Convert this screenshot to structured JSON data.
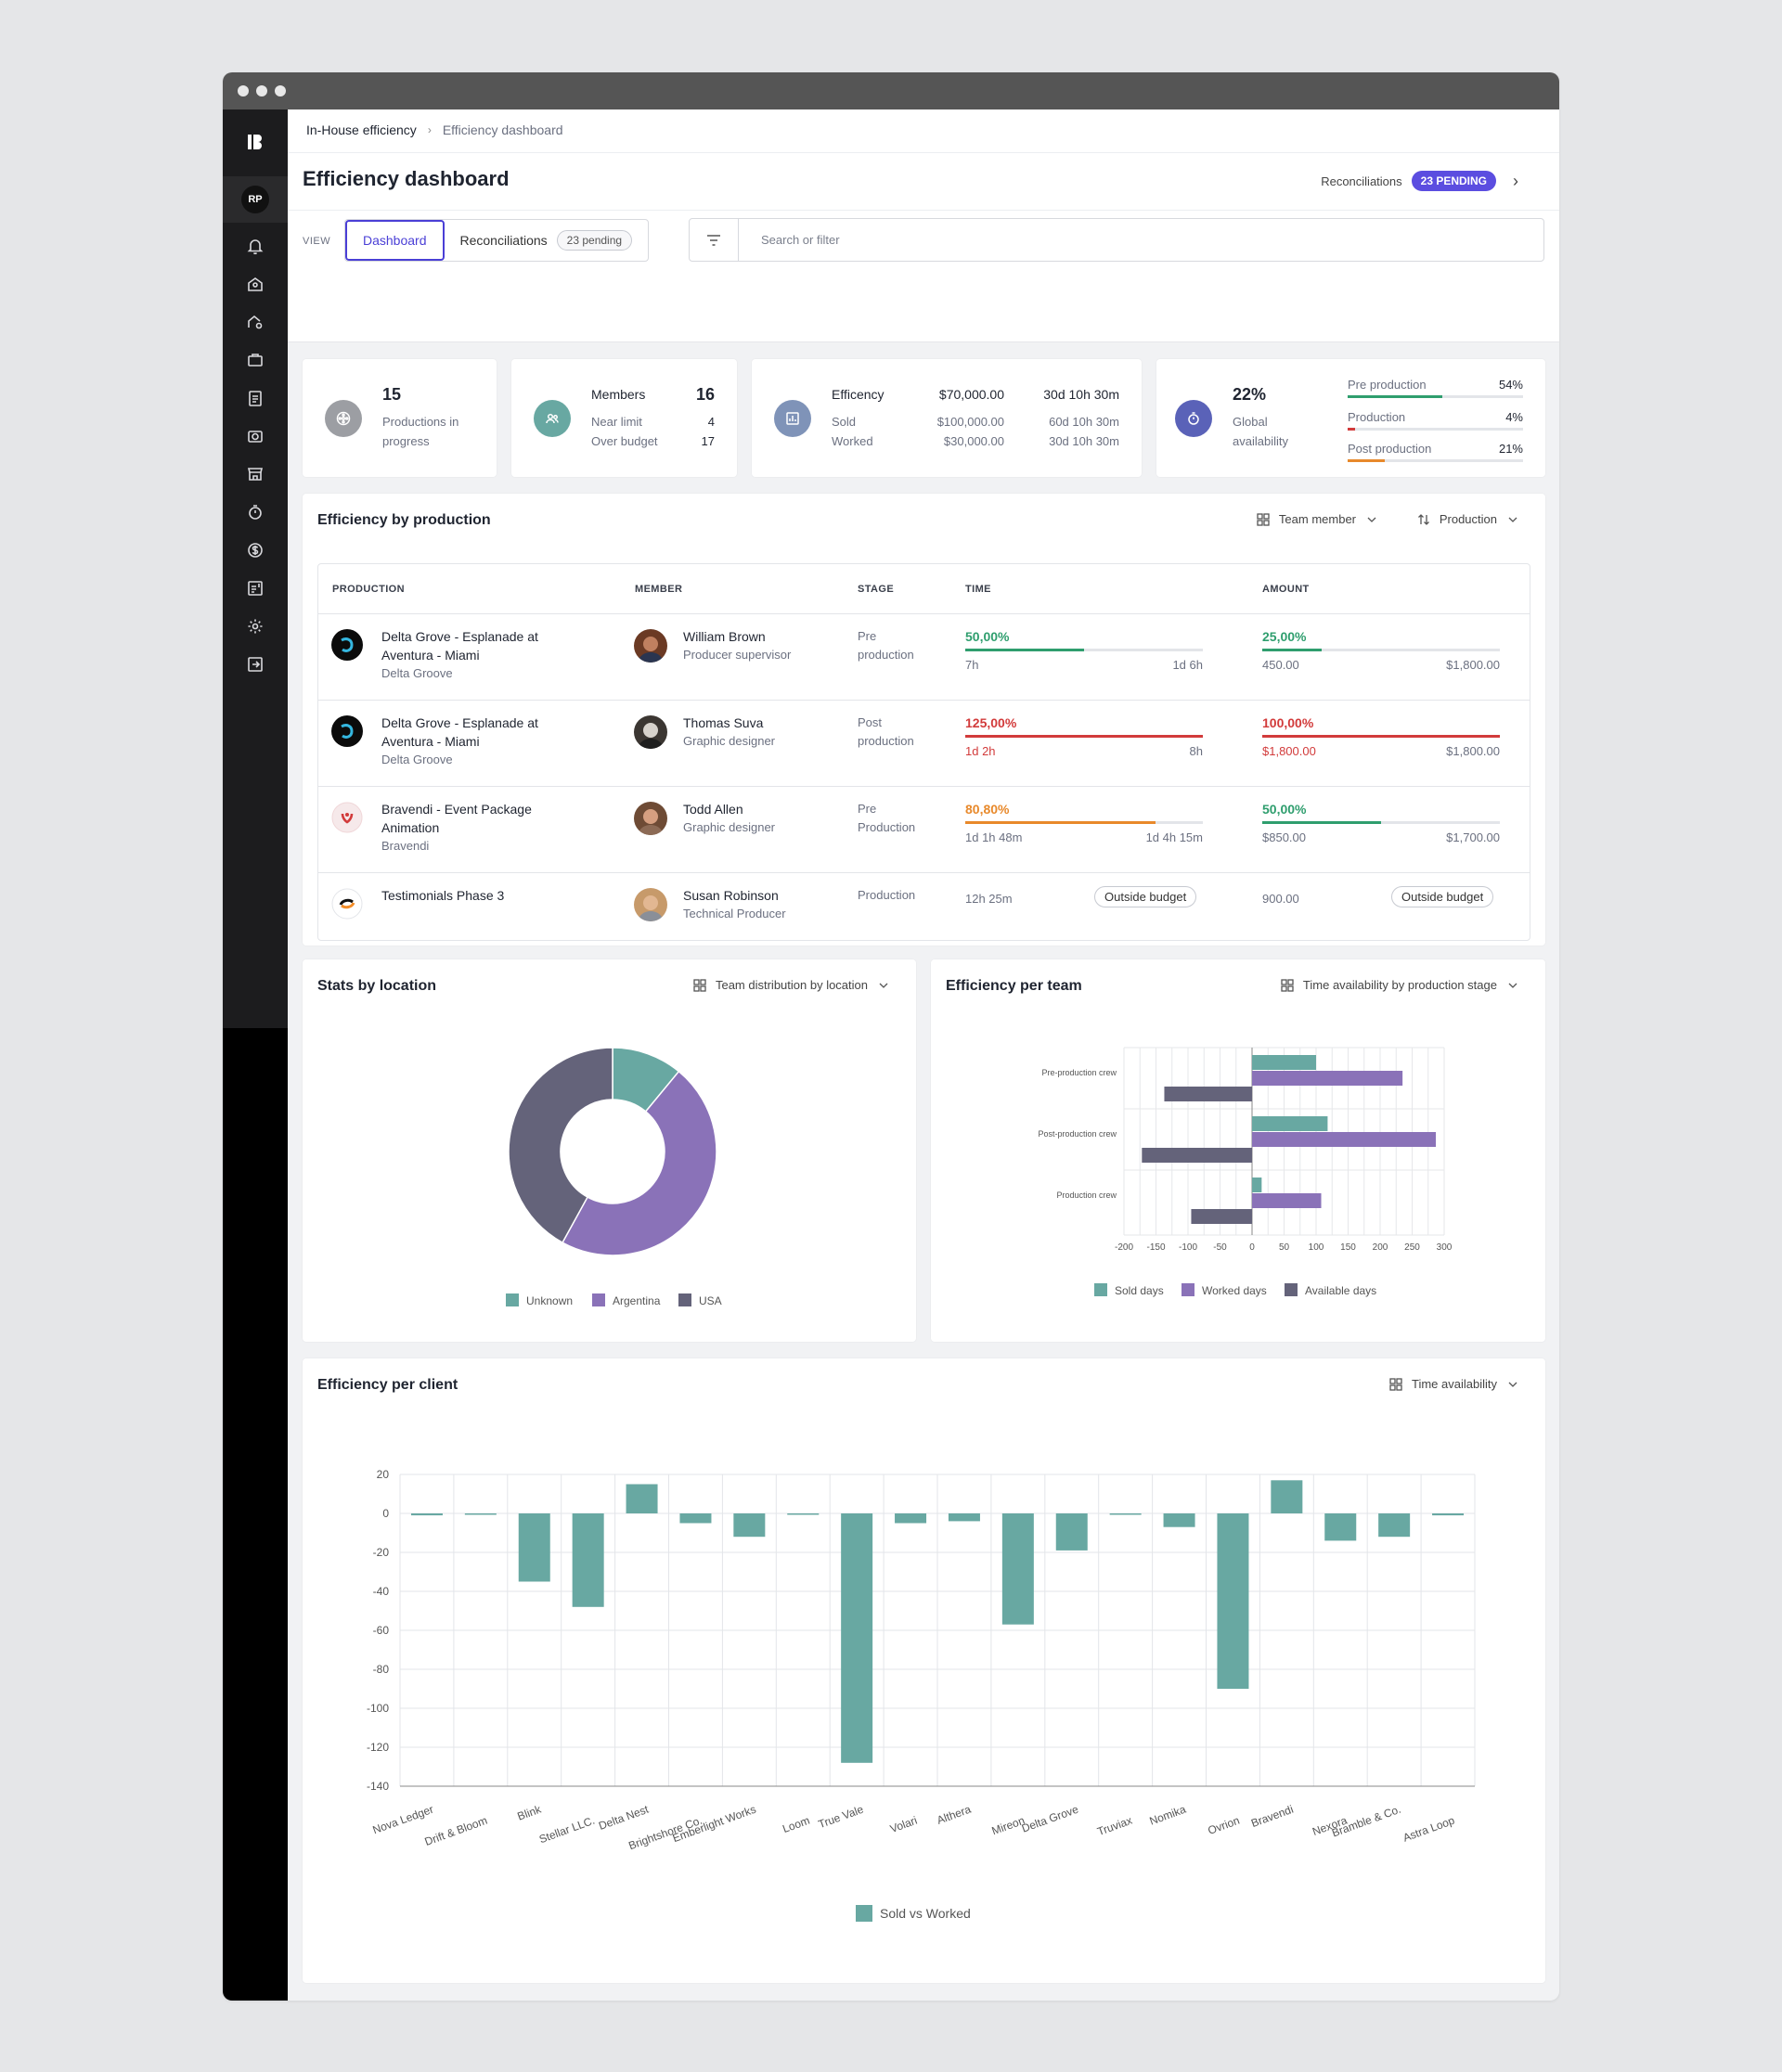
{
  "breadcrumb": {
    "parent": "In-House efficiency",
    "current": "Efficiency dashboard"
  },
  "sidebar": {
    "user_initials": "RP"
  },
  "header": {
    "title": "Efficiency dashboard",
    "reconciliations_label": "Reconciliations",
    "pending_badge": "23 PENDING"
  },
  "view": {
    "label": "VIEW",
    "tabs": [
      {
        "label": "Dashboard"
      },
      {
        "label": "Reconciliations",
        "badge": "23 pending"
      }
    ],
    "search_placeholder": "Search or filter"
  },
  "kpis": {
    "productions": {
      "value": "15",
      "label_line1": "Productions in",
      "label_line2": "progress"
    },
    "members": {
      "title": "Members",
      "total": "16",
      "near_limit_label": "Near limit",
      "near_limit": "4",
      "over_budget_label": "Over budget",
      "over_budget": "17"
    },
    "efficiency": {
      "title": "Efficency",
      "amount": "$70,000.00",
      "time": "30d 10h 30m",
      "sold_label": "Sold",
      "sold_amount": "$100,000.00",
      "sold_time": "60d 10h 30m",
      "worked_label": "Worked",
      "worked_amount": "$30,000.00",
      "worked_time": "30d 10h 30m"
    },
    "availability": {
      "value": "22%",
      "label_line1": "Global",
      "label_line2": "availability",
      "stages": [
        {
          "label": "Pre production",
          "value": "54%",
          "fraction": 0.54,
          "color": "#2f9e6e"
        },
        {
          "label": "Production",
          "value": "4%",
          "fraction": 0.04,
          "color": "#d23b3b"
        },
        {
          "label": "Post production",
          "value": "21%",
          "fraction": 0.21,
          "color": "#e8892b"
        }
      ]
    }
  },
  "efficiency_by_production": {
    "title": "Efficiency by production",
    "filter_team": "Team member",
    "filter_production": "Production",
    "columns": [
      "PRODUCTION",
      "MEMBER",
      "STAGE",
      "TIME",
      "AMOUNT"
    ],
    "rows": [
      {
        "name_line1": "Delta Grove - Esplanade at",
        "name_line2": "Aventura - Miami",
        "client": "Delta Groove",
        "member": "William Brown",
        "role": "Producer supervisor",
        "stage_line1": "Pre",
        "stage_line2": "production",
        "time_pct": "50,00%",
        "time_fraction": 0.5,
        "time_color": "#2f9e6e",
        "time_left": "7h",
        "time_right": "1d 6h",
        "amount_pct": "25,00%",
        "amount_fraction": 0.25,
        "amount_color": "#2f9e6e",
        "amount_left": "450.00",
        "amount_right": "$1,800.00"
      },
      {
        "name_line1": "Delta Grove - Esplanade at",
        "name_line2": "Aventura - Miami",
        "client": "Delta Groove",
        "member": "Thomas Suva",
        "role": "Graphic designer",
        "stage_line1": "Post",
        "stage_line2": "production",
        "time_pct": "125,00%",
        "time_fraction": 1.0,
        "time_color": "#d23b3b",
        "time_left": "1d 2h",
        "time_right": "8h",
        "amount_pct": "100,00%",
        "amount_fraction": 1.0,
        "amount_color": "#d23b3b",
        "amount_left": "$1,800.00",
        "amount_right": "$1,800.00"
      },
      {
        "name_line1": "Bravendi - Event Package",
        "name_line2": "Animation",
        "client": "Bravendi",
        "member": "Todd Allen",
        "role": "Graphic designer",
        "stage_line1": "Pre",
        "stage_line2": "Production",
        "time_pct": "80,80%",
        "time_fraction": 0.8,
        "time_color": "#e8892b",
        "time_left": "1d 1h 48m",
        "time_right": "1d 4h 15m",
        "amount_pct": "50,00%",
        "amount_fraction": 0.5,
        "amount_color": "#2f9e6e",
        "amount_left": "$850.00",
        "amount_right": "$1,700.00"
      },
      {
        "name_line1": "Testimonials Phase 3",
        "member": "Susan Robinson",
        "role": "Technical Producer",
        "stage_line1": "Production",
        "time_left": "12h 25m",
        "time_pill": "Outside budget",
        "amount_left": "900.00",
        "amount_pill": "Outside budget"
      }
    ]
  },
  "stats_by_location": {
    "title": "Stats by location",
    "filter": "Team distribution by location",
    "chart_data": {
      "type": "pie",
      "labels": [
        "Unknown",
        "Argentina",
        "USA"
      ],
      "values": [
        11,
        47,
        42
      ],
      "colors": [
        "#68a8a2",
        "#8a72b8",
        "#64637a"
      ]
    }
  },
  "efficiency_per_team": {
    "title": "Efficiency per team",
    "filter": "Time availability by production stage",
    "chart_data": {
      "type": "bar",
      "orientation": "horizontal",
      "categories": [
        "Pre-production crew",
        "Post-production crew",
        "Production crew"
      ],
      "series": [
        {
          "name": "Sold days",
          "values": [
            100,
            118,
            15
          ],
          "color": "#68a8a2"
        },
        {
          "name": "Worked days",
          "values": [
            235,
            287,
            108
          ],
          "color": "#8a72b8"
        },
        {
          "name": "Available days",
          "values": [
            -137,
            -172,
            -95
          ],
          "color": "#64637a"
        }
      ],
      "xlim": [
        -200,
        300
      ],
      "xticks": [
        -200,
        -150,
        -100,
        -50,
        0,
        50,
        100,
        150,
        200,
        250,
        300
      ]
    }
  },
  "efficiency_per_client": {
    "title": "Efficiency per client",
    "filter": "Time availability",
    "chart_data": {
      "type": "bar",
      "categories": [
        "Nova Ledger",
        "Drift & Bloom",
        "Blink",
        "Stellar LLC.",
        "Delta Nest",
        "Brightshore Co.",
        "Emberlight Works",
        "Loom",
        "True Vale",
        "Volari",
        "Althera",
        "Mireon",
        "Delta Grove",
        "Truviax",
        "Nomika",
        "Ovrion",
        "Bravendi",
        "Nexora",
        "Bramble & Co.",
        "Astra Loop"
      ],
      "series": [
        {
          "name": "Sold vs Worked",
          "values": [
            -1,
            -0.5,
            -35,
            -48,
            15,
            -5,
            -12,
            -0.5,
            -128,
            -5,
            -4,
            -57,
            -19,
            -0.5,
            -7,
            -90,
            17,
            -14,
            -12,
            -1
          ],
          "color": "#68a8a2"
        }
      ],
      "ylim": [
        -140,
        20
      ],
      "yticks": [
        20,
        0,
        -20,
        -40,
        -60,
        -80,
        -100,
        -120,
        -140
      ]
    }
  }
}
